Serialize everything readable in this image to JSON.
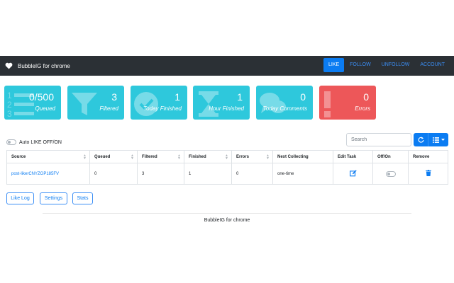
{
  "navbar": {
    "brand": "BubbleIG for chrome",
    "items": [
      {
        "label": "LIKE",
        "active": true
      },
      {
        "label": "FOLLOW",
        "active": false
      },
      {
        "label": "UNFOLLOW",
        "active": false
      },
      {
        "label": "ACCOUNT",
        "active": false
      }
    ]
  },
  "stats": [
    {
      "value": "0/500",
      "label": "Queued",
      "color": "#2ec8dc",
      "icon": "list-icon"
    },
    {
      "value": "3",
      "label": "Filtered",
      "color": "#2ec8dc",
      "icon": "funnel-icon"
    },
    {
      "value": "1",
      "label": "Today Finished",
      "color": "#2ec8dc",
      "icon": "check-circle-icon"
    },
    {
      "value": "1",
      "label": "Hour Finished",
      "color": "#2ec8dc",
      "icon": "hourglass-icon"
    },
    {
      "value": "0",
      "label": "Today Comments",
      "color": "#2ec8dc",
      "icon": "comments-icon"
    },
    {
      "value": "0",
      "label": "Errors",
      "color": "#ed5759",
      "icon": "exclamation-icon"
    }
  ],
  "toggle": {
    "label": "Auto LIKE OFF/ON",
    "state": "off"
  },
  "search": {
    "placeholder": "Search",
    "value": ""
  },
  "table": {
    "columns": [
      "Source",
      "Queued",
      "Filtered",
      "Finished",
      "Errors",
      "Next Collecting",
      "Edit Task",
      "Off/On",
      "Remove"
    ],
    "rows": [
      {
        "source": "post-likerCNYZGP185FV",
        "queued": "0",
        "filtered": "3",
        "finished": "1",
        "errors": "0",
        "next_collecting": "one-time",
        "toggle_state": "off"
      }
    ]
  },
  "buttons": {
    "like_log": "Like Log",
    "settings": "Settings",
    "stats": "Stats"
  },
  "footer": "BubbleIG for chrome",
  "colors": {
    "accent": "#0b7cf2",
    "navbar": "#2b3035",
    "teal": "#2ec8dc",
    "red": "#ed5759"
  }
}
